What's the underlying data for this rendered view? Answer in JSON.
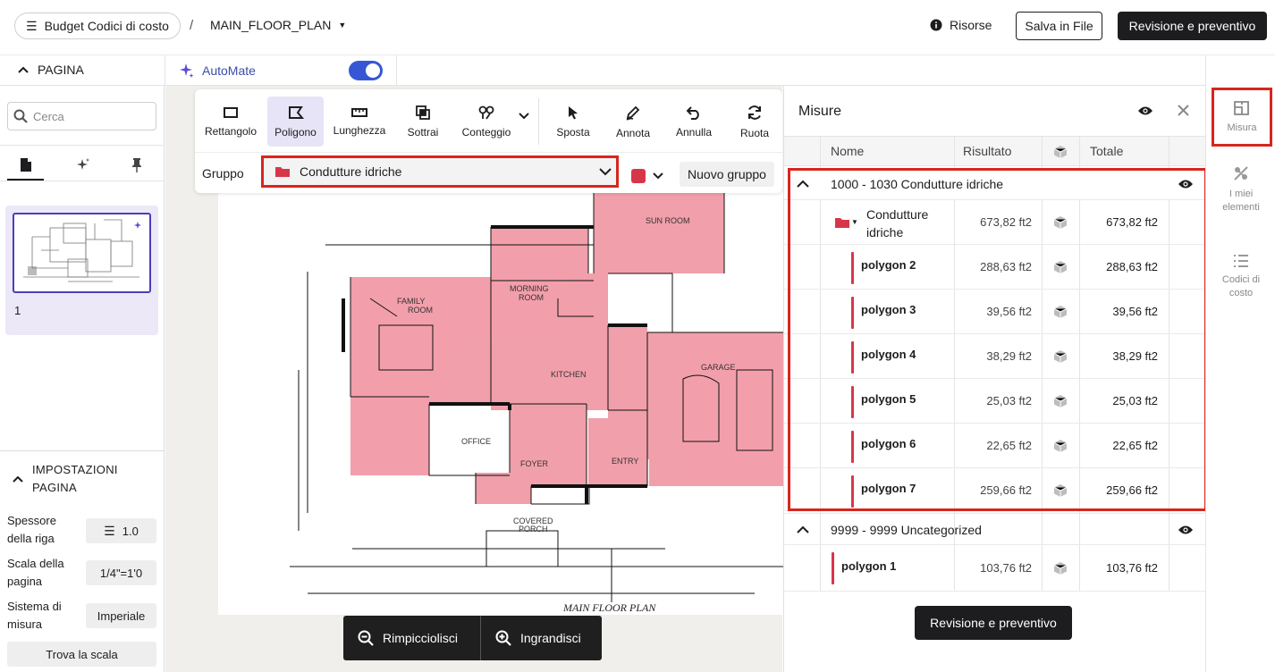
{
  "topbar": {
    "budget_label": "Budget Codici di costo",
    "separator": "/",
    "file_name": "MAIN_FLOOR_PLAN",
    "resources_label": "Risorse",
    "save_label": "Salva in File",
    "review_label": "Revisione e preventivo"
  },
  "subbar": {
    "page_label": "PAGINA",
    "automate_label": "AutoMate",
    "automate_on": true
  },
  "sidebar": {
    "search_placeholder": "Cerca",
    "tabs": [
      "page-icon",
      "sparkle-icon",
      "pin-icon"
    ],
    "page_number": "1",
    "settings_title": "IMPOSTAZIONI PAGINA",
    "settings": [
      {
        "label": "Spessore della riga",
        "value": "1.0"
      },
      {
        "label": "Scala della pagina",
        "value": "1/4\"=1'0"
      },
      {
        "label": "Sistema di misura",
        "value": "Imperiale"
      }
    ],
    "find_scale_label": "Trova la scala"
  },
  "toolbar": {
    "tools": [
      {
        "label": "Rettangolo",
        "icon": "rectangle-icon"
      },
      {
        "label": "Poligono",
        "icon": "polygon-icon",
        "active": true
      },
      {
        "label": "Lunghezza",
        "icon": "ruler-icon"
      },
      {
        "label": "Sottrai",
        "icon": "subtract-icon"
      },
      {
        "label": "Conteggio",
        "icon": "count-icon"
      },
      {
        "label": "Sposta",
        "icon": "cursor-icon"
      },
      {
        "label": "Annota",
        "icon": "pen-icon"
      },
      {
        "label": "Annulla",
        "icon": "undo-icon"
      },
      {
        "label": "Ruota",
        "icon": "rotate-icon"
      }
    ],
    "group_label": "Gruppo",
    "group_value": "Condutture idriche",
    "group_color": "#d7364a",
    "new_group_label": "Nuovo gruppo"
  },
  "plan": {
    "title": "MAIN FLOOR PLAN",
    "rooms": [
      "SUN ROOM",
      "FAMILY ROOM",
      "MORNING ROOM",
      "KITCHEN",
      "GARAGE",
      "OFFICE",
      "FOYER",
      "ENTRY",
      "COVERED PORCH"
    ]
  },
  "zoom": {
    "zoom_out_label": "Rimpicciolisci",
    "zoom_in_label": "Ingrandisci"
  },
  "panel": {
    "title": "Misure",
    "columns": {
      "name": "Nome",
      "result": "Risultato",
      "total": "Totale"
    },
    "group1": {
      "title": "1000 - 1030 Condutture idriche",
      "folder_name": "Condutture idriche",
      "folder_result": "673,82 ft2",
      "folder_total": "673,82 ft2",
      "items": [
        {
          "name": "polygon 2",
          "result": "288,63 ft2",
          "total": "288,63 ft2"
        },
        {
          "name": "polygon 3",
          "result": "39,56 ft2",
          "total": "39,56 ft2"
        },
        {
          "name": "polygon 4",
          "result": "38,29 ft2",
          "total": "38,29 ft2"
        },
        {
          "name": "polygon 5",
          "result": "25,03 ft2",
          "total": "25,03 ft2"
        },
        {
          "name": "polygon 6",
          "result": "22,65 ft2",
          "total": "22,65 ft2"
        },
        {
          "name": "polygon 7",
          "result": "259,66 ft2",
          "total": "259,66 ft2"
        }
      ]
    },
    "group2": {
      "title": "9999 - 9999 Uncategorized",
      "items": [
        {
          "name": "polygon 1",
          "result": "103,76 ft2",
          "total": "103,76 ft2"
        }
      ]
    },
    "review_label": "Revisione e preventivo"
  },
  "rail": {
    "items": [
      {
        "label": "Misura",
        "icon": "measure-icon"
      },
      {
        "label": "I miei elementi",
        "icon": "elements-icon"
      },
      {
        "label": "Codici di costo",
        "icon": "list-icon"
      }
    ]
  },
  "colors": {
    "accent_red": "#d7261e",
    "fill_pink": "#f19aa6",
    "toggle_blue": "#3557d6",
    "dark": "#1d1d1f"
  }
}
